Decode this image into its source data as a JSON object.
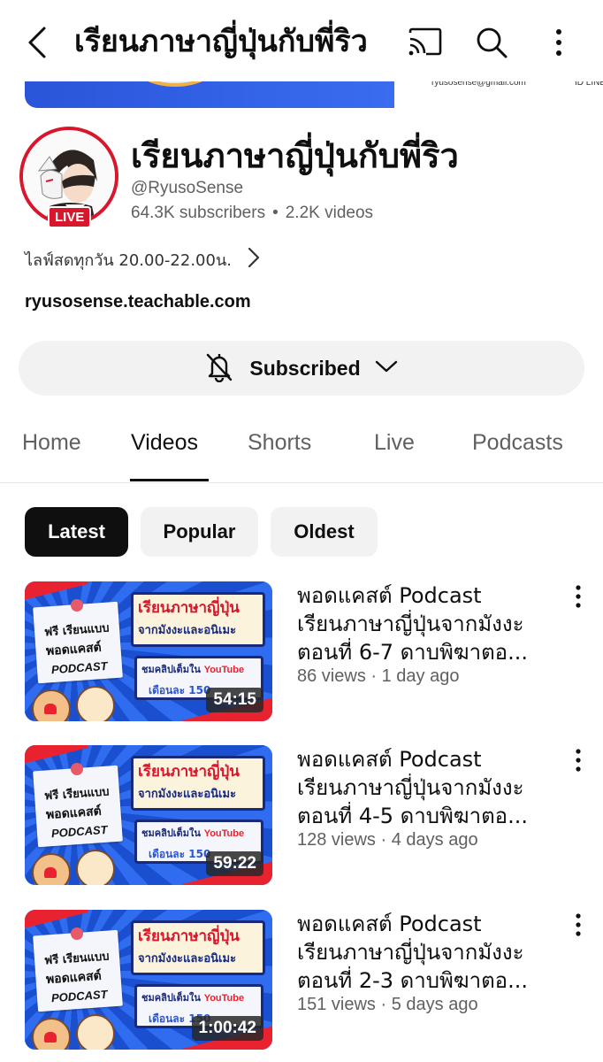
{
  "topbar": {
    "title": "เรียนภาษาญี่ปุ่นกับพี่ริว",
    "icons": [
      "back-arrow-icon",
      "cast-icon",
      "search-icon",
      "more-vertical-icon"
    ]
  },
  "banner": {
    "email": "ryusosense@gmail.com",
    "line_id": "ID LINE r"
  },
  "channel": {
    "name": "เรียนภาษาญี่ปุ่นกับพี่ริว",
    "handle": "@RyusoSense",
    "subscribers": "64.3K subscribers",
    "separator": "•",
    "videos": "2.2K videos",
    "live_badge": "LIVE",
    "description": "ไลฟ์สดทุกวัน 20.00-22.00น.",
    "link": "ryusosense.teachable.com",
    "subscribe_label": "Subscribed"
  },
  "tabs": [
    {
      "label": "Home"
    },
    {
      "label": "Videos"
    },
    {
      "label": "Shorts"
    },
    {
      "label": "Live"
    },
    {
      "label": "Podcasts"
    }
  ],
  "active_tab": "Videos",
  "chips": [
    {
      "label": "Latest"
    },
    {
      "label": "Popular"
    },
    {
      "label": "Oldest"
    }
  ],
  "active_chip": "Latest",
  "thumbnail_text": {
    "paper_l1": "ฟรี เรียนแบบ",
    "paper_l2": "พอดแคสต์",
    "paper_l3": "PODCAST",
    "card1_l1": "เรียนภาษาญี่ปุ่น",
    "card1_l2": "จากมังงะและอนิเมะ",
    "card2_l1": "ชมคลิปเต็มใน ",
    "card2_yt": "YouTube",
    "card2_l2": "เดือนละ 150"
  },
  "videos": [
    {
      "title_l1": "พอดแคสต์ Podcast",
      "title_l2": "เรียนภาษาญี่ปุ่นจากมังงะ",
      "title_l3": "ตอนที่ 6-7 ดาบพิฆาตอ...",
      "views": "86 views",
      "sep": " · ",
      "age": "1 day ago",
      "duration": "54:15"
    },
    {
      "title_l1": "พอดแคสต์ Podcast",
      "title_l2": "เรียนภาษาญี่ปุ่นจากมังงะ",
      "title_l3": "ตอนที่ 4-5 ดาบพิฆาตอ...",
      "views": "128 views",
      "sep": " · ",
      "age": "4 days ago",
      "duration": "59:22"
    },
    {
      "title_l1": "พอดแคสต์ Podcast",
      "title_l2": "เรียนภาษาญี่ปุ่นจากมังงะ",
      "title_l3": "ตอนที่ 2-3 ดาบพิฆาตอ...",
      "views": "151 views",
      "sep": " · ",
      "age": "5 days ago",
      "duration": "1:00:42"
    }
  ],
  "colors": {
    "live_red": "#d8172c",
    "chip_active_bg": "#0f0f0f",
    "chip_bg": "#f2f2f2",
    "secondary_text": "#606060"
  }
}
